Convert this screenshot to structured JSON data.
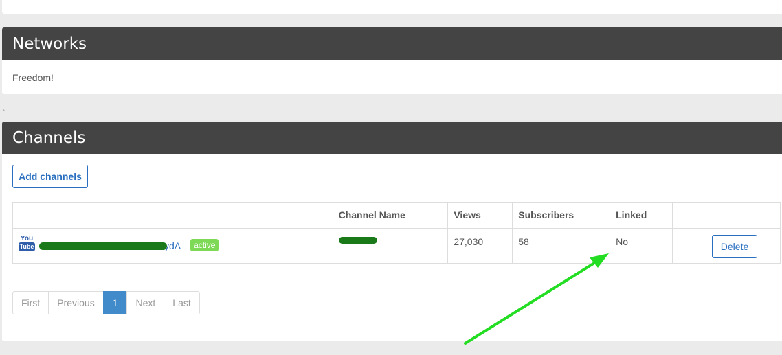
{
  "networks": {
    "title": "Networks",
    "body": "Freedom!"
  },
  "tick_mark": "`",
  "channels": {
    "title": "Channels",
    "add_button": "Add channels",
    "columns": [
      "",
      "Channel Name",
      "Views",
      "Subscribers",
      "Linked",
      "",
      ""
    ],
    "rows": [
      {
        "icon": "youtube-icon",
        "icon_you": "You",
        "icon_tube": "Tube",
        "channel_id_suffix": "ydA",
        "status": "active",
        "channel_name": "",
        "views": "27,030",
        "subscribers": "58",
        "linked": "No",
        "delete_label": "Delete"
      }
    ]
  },
  "pagination": {
    "first": "First",
    "previous": "Previous",
    "current": "1",
    "next": "Next",
    "last": "Last"
  },
  "colors": {
    "heading_bg": "#444444",
    "link": "#2a6fbf",
    "active_badge": "#7ed957",
    "active_page": "#428bca",
    "annotation_arrow": "#22dd22",
    "redaction": "#1a7a1a"
  }
}
